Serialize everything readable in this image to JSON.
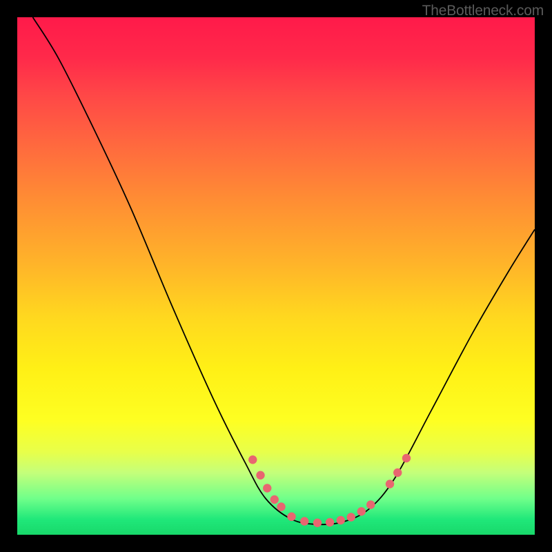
{
  "watermark": "TheBottleneck.com",
  "chart_data": {
    "type": "line",
    "title": "",
    "xlabel": "",
    "ylabel": "",
    "xlim": [
      0,
      100
    ],
    "ylim": [
      0,
      100
    ],
    "curve_points": [
      {
        "x": 3,
        "y": 100
      },
      {
        "x": 8,
        "y": 92
      },
      {
        "x": 15,
        "y": 78
      },
      {
        "x": 22,
        "y": 63
      },
      {
        "x": 30,
        "y": 44
      },
      {
        "x": 38,
        "y": 26
      },
      {
        "x": 44,
        "y": 14
      },
      {
        "x": 48,
        "y": 7
      },
      {
        "x": 53,
        "y": 3
      },
      {
        "x": 58,
        "y": 2
      },
      {
        "x": 63,
        "y": 2.5
      },
      {
        "x": 68,
        "y": 5
      },
      {
        "x": 73,
        "y": 11
      },
      {
        "x": 80,
        "y": 24
      },
      {
        "x": 88,
        "y": 39
      },
      {
        "x": 95,
        "y": 51
      },
      {
        "x": 100,
        "y": 59
      }
    ],
    "markers": [
      {
        "x": 45.5,
        "y": 14.5
      },
      {
        "x": 47,
        "y": 11.5
      },
      {
        "x": 48.3,
        "y": 9
      },
      {
        "x": 49.7,
        "y": 6.8
      },
      {
        "x": 51,
        "y": 5.4
      },
      {
        "x": 53,
        "y": 3.5
      },
      {
        "x": 55.5,
        "y": 2.6
      },
      {
        "x": 58,
        "y": 2.3
      },
      {
        "x": 60.4,
        "y": 2.4
      },
      {
        "x": 62.5,
        "y": 2.8
      },
      {
        "x": 64.5,
        "y": 3.4
      },
      {
        "x": 66.5,
        "y": 4.5
      },
      {
        "x": 68.3,
        "y": 5.8
      },
      {
        "x": 72,
        "y": 9.8
      },
      {
        "x": 73.5,
        "y": 12
      },
      {
        "x": 75.2,
        "y": 14.8
      }
    ]
  }
}
